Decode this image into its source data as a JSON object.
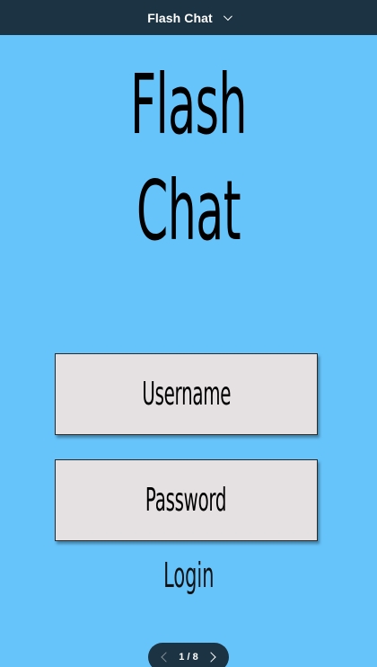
{
  "header": {
    "title": "Flash Chat"
  },
  "app": {
    "title_line1": "Flash",
    "title_line2": "Chat"
  },
  "form": {
    "username_placeholder": "Username",
    "password_placeholder": "Password",
    "login_label": "Login"
  },
  "pager": {
    "label": "1 / 8"
  },
  "colors": {
    "background": "#66c4fb",
    "header": "#1b3342",
    "field": "#e5e0e1"
  },
  "icons": {
    "header_dropdown": "chevron-down-icon",
    "pager_prev": "chevron-left-icon",
    "pager_next": "chevron-right-icon"
  }
}
